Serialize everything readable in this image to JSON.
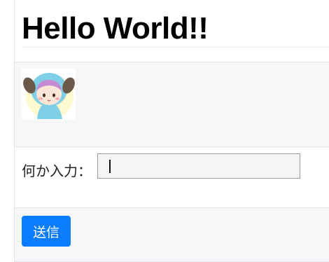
{
  "page": {
    "title": "Hello World!!"
  },
  "image": {
    "alt": "character-avatar"
  },
  "form": {
    "input_label": "何か入力：",
    "input_value": "",
    "submit_label": "送信"
  },
  "colors": {
    "button_bg": "#0a7cff",
    "section_alt_bg": "#f6f7f9"
  }
}
